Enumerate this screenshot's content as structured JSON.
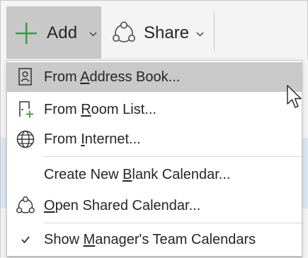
{
  "ribbon": {
    "add_label": "Add",
    "share_label": "Share"
  },
  "menu": {
    "items": [
      {
        "pre": "From ",
        "accel": "A",
        "post": "ddress Book...",
        "icon": "address-book-icon",
        "hovered": true
      },
      {
        "pre": "From ",
        "accel": "R",
        "post": "oom List...",
        "icon": "room-list-icon"
      },
      {
        "pre": "From ",
        "accel": "I",
        "post": "nternet...",
        "icon": "globe-icon"
      },
      {
        "pre": "Create New ",
        "accel": "B",
        "post": "lank Calendar...",
        "icon": ""
      },
      {
        "pre": "",
        "accel": "O",
        "post": "pen Shared Calendar...",
        "icon": "share-icon"
      },
      {
        "pre": "Show ",
        "accel": "M",
        "post": "anager's Team Calendars",
        "icon": "checkmark-icon"
      }
    ]
  },
  "colors": {
    "accent_green": "#2e9e3e",
    "hover_gray": "#c9c9c9",
    "pressed_gray": "#c8c8c8"
  }
}
